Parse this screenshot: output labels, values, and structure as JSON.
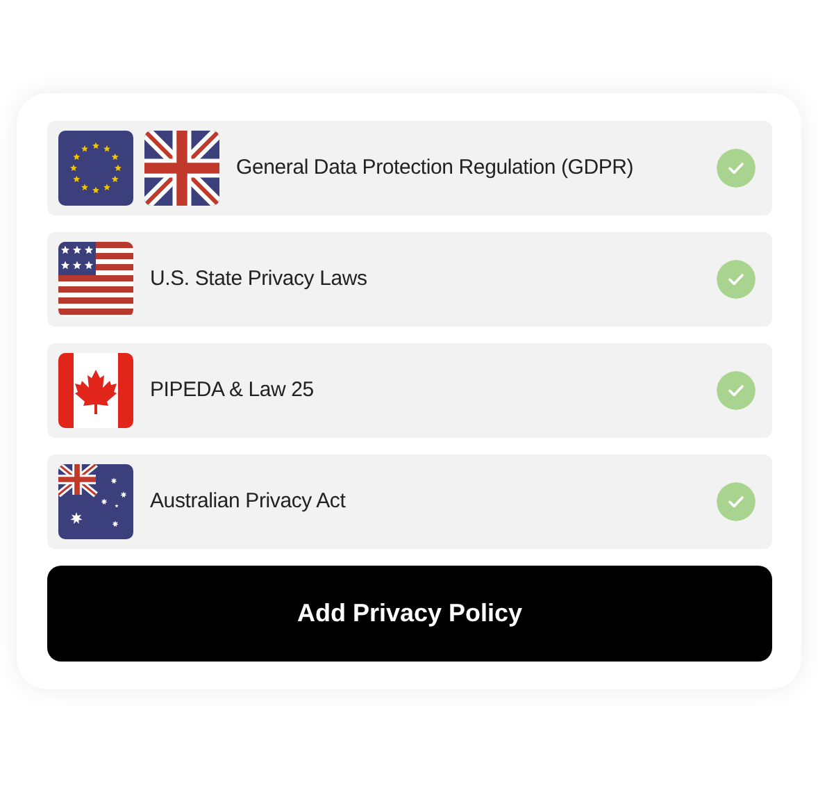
{
  "policies": [
    {
      "label": "General Data Protection Regulation (GDPR)",
      "flags": [
        {
          "kind": "eu"
        },
        {
          "kind": "uk"
        }
      ],
      "checked": true
    },
    {
      "label": "U.S. State Privacy Laws",
      "flags": [
        {
          "kind": "us"
        }
      ],
      "checked": true
    },
    {
      "label": "PIPEDA & Law 25",
      "flags": [
        {
          "kind": "ca"
        }
      ],
      "checked": true
    },
    {
      "label": "Australian Privacy Act",
      "flags": [
        {
          "kind": "au"
        }
      ],
      "checked": true
    }
  ],
  "button": "Add Privacy Policy"
}
